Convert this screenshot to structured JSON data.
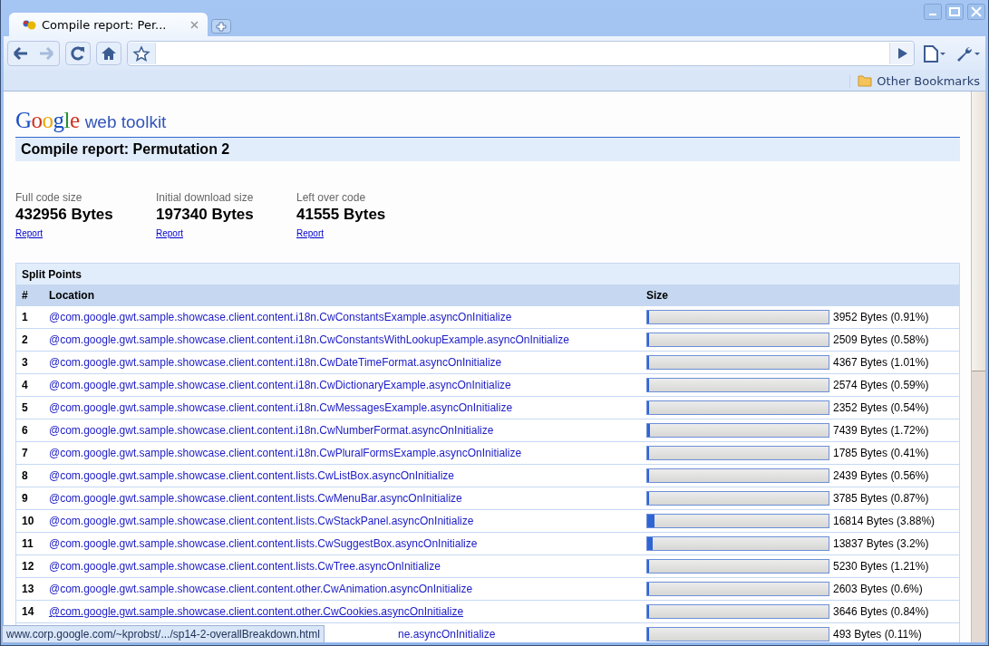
{
  "browser": {
    "tabs": [
      {
        "title": "Compile report: Per...",
        "selected": true
      }
    ],
    "bookmarks": [
      {
        "label": "Other Bookmarks"
      }
    ]
  },
  "page": {
    "logo": {
      "brand": "Google",
      "product": "web toolkit"
    },
    "title": "Compile report: Permutation 2",
    "stats": [
      {
        "label": "Full code size",
        "value": "432956 Bytes",
        "link": "Report"
      },
      {
        "label": "Initial download size",
        "value": "197340 Bytes",
        "link": "Report"
      },
      {
        "label": "Left over code",
        "value": "41555 Bytes",
        "link": "Report"
      }
    ],
    "split_points": {
      "title": "Split Points",
      "columns": [
        "#",
        "Location",
        "Size"
      ],
      "rows": [
        {
          "index": "1",
          "location": "@com.google.gwt.sample.showcase.client.content.i18n.CwConstantsExample.asyncOnInitialize",
          "size": "3952 Bytes (0.91%)",
          "level": 0.009,
          "hovered": false
        },
        {
          "index": "2",
          "location": "@com.google.gwt.sample.showcase.client.content.i18n.CwConstantsWithLookupExample.asyncOnInitialize",
          "size": "2509 Bytes (0.58%)",
          "level": 0.006,
          "hovered": false
        },
        {
          "index": "3",
          "location": "@com.google.gwt.sample.showcase.client.content.i18n.CwDateTimeFormat.asyncOnInitialize",
          "size": "4367 Bytes (1.01%)",
          "level": 0.01,
          "hovered": false
        },
        {
          "index": "4",
          "location": "@com.google.gwt.sample.showcase.client.content.i18n.CwDictionaryExample.asyncOnInitialize",
          "size": "2574 Bytes (0.59%)",
          "level": 0.006,
          "hovered": false
        },
        {
          "index": "5",
          "location": "@com.google.gwt.sample.showcase.client.content.i18n.CwMessagesExample.asyncOnInitialize",
          "size": "2352 Bytes (0.54%)",
          "level": 0.005,
          "hovered": false
        },
        {
          "index": "6",
          "location": "@com.google.gwt.sample.showcase.client.content.i18n.CwNumberFormat.asyncOnInitialize",
          "size": "7439 Bytes (1.72%)",
          "level": 0.017,
          "hovered": false
        },
        {
          "index": "7",
          "location": "@com.google.gwt.sample.showcase.client.content.i18n.CwPluralFormsExample.asyncOnInitialize",
          "size": "1785 Bytes (0.41%)",
          "level": 0.004,
          "hovered": false
        },
        {
          "index": "8",
          "location": "@com.google.gwt.sample.showcase.client.content.lists.CwListBox.asyncOnInitialize",
          "size": "2439 Bytes (0.56%)",
          "level": 0.006,
          "hovered": false
        },
        {
          "index": "9",
          "location": "@com.google.gwt.sample.showcase.client.content.lists.CwMenuBar.asyncOnInitialize",
          "size": "3785 Bytes (0.87%)",
          "level": 0.009,
          "hovered": false
        },
        {
          "index": "10",
          "location": "@com.google.gwt.sample.showcase.client.content.lists.CwStackPanel.asyncOnInitialize",
          "size": "16814 Bytes (3.88%)",
          "level": 0.039,
          "hovered": false
        },
        {
          "index": "11",
          "location": "@com.google.gwt.sample.showcase.client.content.lists.CwSuggestBox.asyncOnInitialize",
          "size": "13837 Bytes (3.2%)",
          "level": 0.032,
          "hovered": false
        },
        {
          "index": "12",
          "location": "@com.google.gwt.sample.showcase.client.content.lists.CwTree.asyncOnInitialize",
          "size": "5230 Bytes (1.21%)",
          "level": 0.012,
          "hovered": false
        },
        {
          "index": "13",
          "location": "@com.google.gwt.sample.showcase.client.content.other.CwAnimation.asyncOnInitialize",
          "size": "2603 Bytes (0.6%)",
          "level": 0.006,
          "hovered": false
        },
        {
          "index": "14",
          "location": "@com.google.gwt.sample.showcase.client.content.other.CwCookies.asyncOnInitialize",
          "size": "3646 Bytes (0.84%)",
          "level": 0.008,
          "hovered": true
        },
        {
          "location": "ne.asyncOnInitialize",
          "size": "493 Bytes (0.11%)",
          "level": 0.001
        }
      ]
    }
  },
  "status_bubble": "www.corp.google.com/~kprobst/.../sp14-2-overallBreakdown.html"
}
